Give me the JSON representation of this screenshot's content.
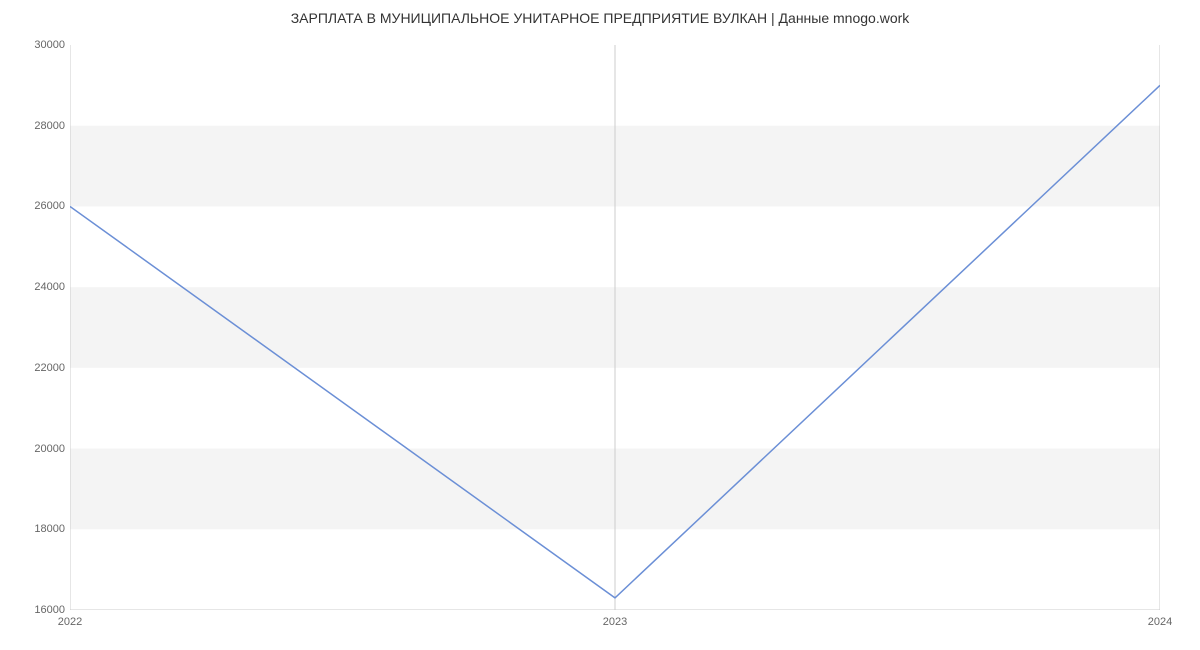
{
  "chart_data": {
    "type": "line",
    "title": "ЗАРПЛАТА В МУНИЦИПАЛЬНОЕ УНИТАРНОЕ ПРЕДПРИЯТИЕ ВУЛКАН | Данные mnogo.work",
    "xlabel": "",
    "ylabel": "",
    "categories": [
      "2022",
      "2023",
      "2024"
    ],
    "values": [
      26000,
      16300,
      29000
    ],
    "x_ticks": [
      "2022",
      "2023",
      "2024"
    ],
    "y_ticks": [
      16000,
      18000,
      20000,
      22000,
      24000,
      26000,
      28000,
      30000
    ],
    "ylim": [
      16000,
      30000
    ],
    "line_color": "#6b8fd6",
    "band_color": "#f4f4f4",
    "axis_color": "#cccccc"
  }
}
